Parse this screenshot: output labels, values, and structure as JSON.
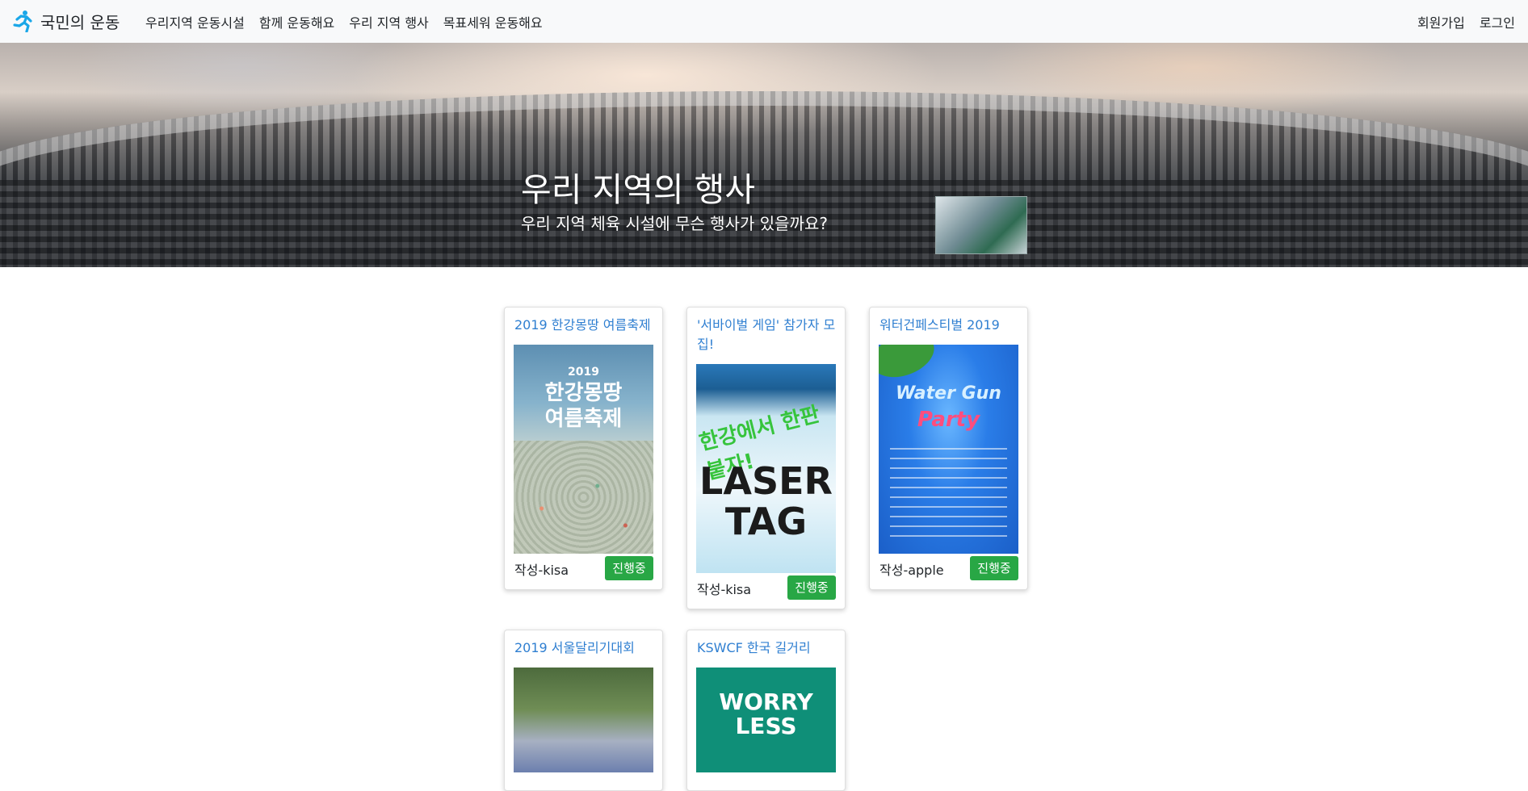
{
  "brand": {
    "name": "국민의 운동",
    "icon": "runner-icon",
    "icon_color": "#1aa7e8"
  },
  "nav": {
    "items": [
      "우리지역 운동시설",
      "함께 운동해요",
      "우리 지역 행사",
      "목표세워 운동해요"
    ],
    "right": [
      "회원가입",
      "로그인"
    ]
  },
  "hero": {
    "title": "우리 지역의 행사",
    "subtitle": "우리 지역 체육 시설에 무슨 행사가 있을까요?"
  },
  "cards": [
    {
      "title": "2019 한강몽땅 여름축제",
      "author": "작성-kisa",
      "status": "진행중",
      "poster": {
        "line1": "2019",
        "line2": "한강몽땅\n여름축제"
      }
    },
    {
      "title": "'서바이벌 게임' 참가자 모집!",
      "author": "작성-kisa",
      "status": "진행중",
      "poster": {
        "line1": "한강에서 한판붙자!",
        "line2": "LASER\nTAG"
      }
    },
    {
      "title": "워터건페스티벌 2019",
      "author": "작성-apple",
      "status": "진행중",
      "poster": {
        "line1": "Water Gun",
        "line2": "Party"
      }
    },
    {
      "title": "2019 서울달리기대회"
    },
    {
      "title": "KSWCF 한국 길거리",
      "poster": {
        "line1": "WORRY\nLESS"
      }
    }
  ],
  "colors": {
    "link": "#2f7fd1",
    "badge": "#28a745",
    "navbar_bg": "#f8f9fa"
  }
}
